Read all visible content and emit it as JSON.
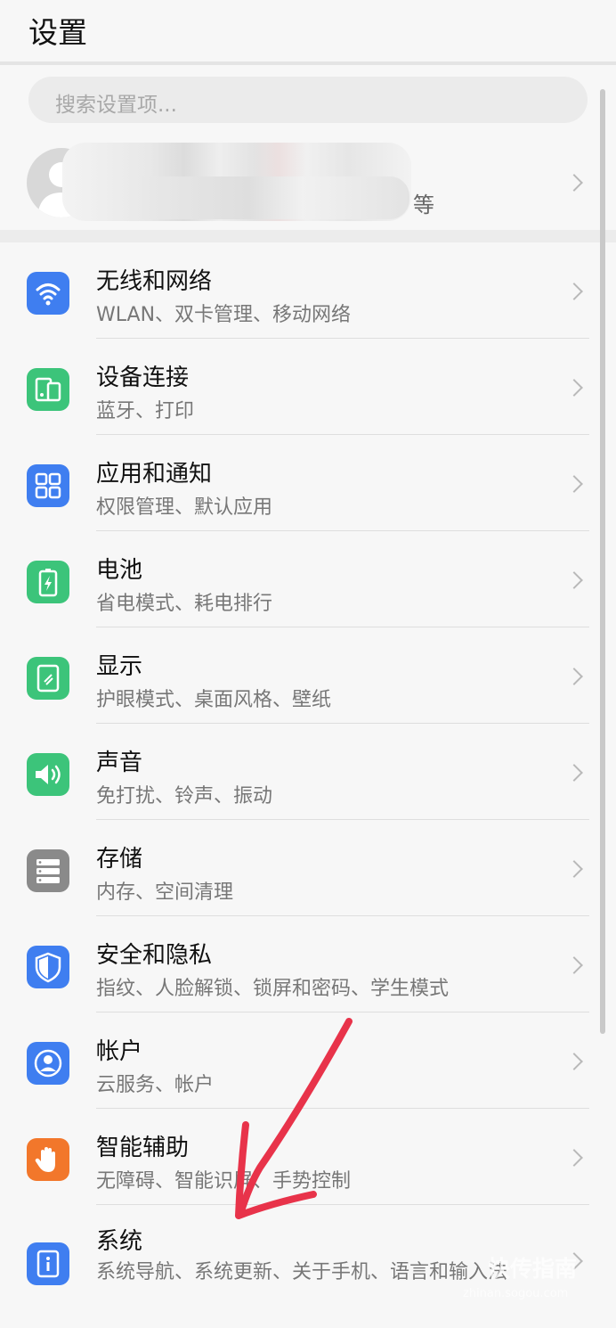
{
  "header": {
    "title": "设置"
  },
  "search": {
    "placeholder": "搜索设置项..."
  },
  "account": {
    "subtitle_tail": "等"
  },
  "items": [
    {
      "title": "无线和网络",
      "subtitle": "WLAN、双卡管理、移动网络",
      "icon": "wifi-icon",
      "color": "#3f7ef0"
    },
    {
      "title": "设备连接",
      "subtitle": "蓝牙、打印",
      "icon": "device-connection-icon",
      "color": "#3cc47a"
    },
    {
      "title": "应用和通知",
      "subtitle": "权限管理、默认应用",
      "icon": "apps-grid-icon",
      "color": "#3f7ef0"
    },
    {
      "title": "电池",
      "subtitle": "省电模式、耗电排行",
      "icon": "battery-icon",
      "color": "#3cc47a"
    },
    {
      "title": "显示",
      "subtitle": "护眼模式、桌面风格、壁纸",
      "icon": "display-icon",
      "color": "#3cc47a"
    },
    {
      "title": "声音",
      "subtitle": "免打扰、铃声、振动",
      "icon": "speaker-icon",
      "color": "#3cc47a"
    },
    {
      "title": "存储",
      "subtitle": "内存、空间清理",
      "icon": "storage-icon",
      "color": "#8a8a8a"
    },
    {
      "title": "安全和隐私",
      "subtitle": "指纹、人脸解锁、锁屏和密码、学生模式",
      "icon": "shield-icon",
      "color": "#3f7ef0"
    },
    {
      "title": "帐户",
      "subtitle": "云服务、帐户",
      "icon": "account-icon",
      "color": "#3f7ef0"
    },
    {
      "title": "智能辅助",
      "subtitle": "无障碍、智能识屏、手势控制",
      "icon": "hand-icon",
      "color": "#f2772b"
    },
    {
      "title": "系统",
      "subtitle": "系统导航、系统更新、关于手机、语言和输入法",
      "icon": "system-info-icon",
      "color": "#3f7ef0"
    }
  ],
  "watermark": {
    "text": "快传指南",
    "url_text": "zhinan.sogou.com"
  }
}
